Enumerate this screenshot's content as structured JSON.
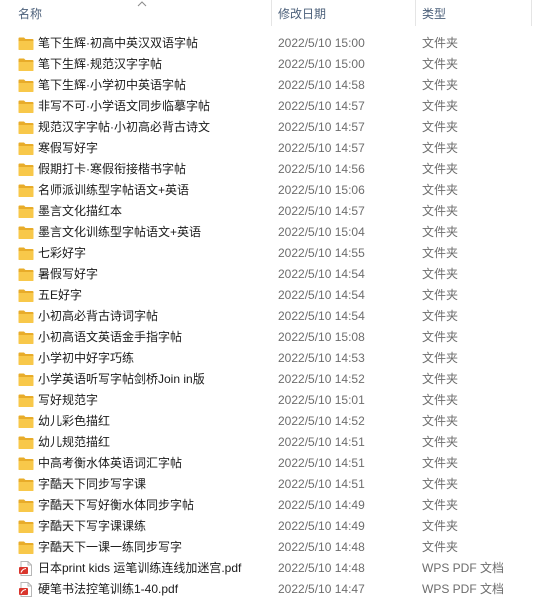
{
  "header": {
    "name_label": "名称",
    "date_label": "修改日期",
    "type_label": "类型"
  },
  "icons": {
    "folder": "folder-icon",
    "pdf": "pdf-icon"
  },
  "colors": {
    "folder": "#f8c84a",
    "pdf_accent": "#d9352c"
  },
  "files": [
    {
      "name": "笔下生辉·初高中英汉双语字帖",
      "date": "2022/5/10 15:00",
      "type": "文件夹",
      "kind": "folder"
    },
    {
      "name": "笔下生辉·规范汉字字帖",
      "date": "2022/5/10 15:00",
      "type": "文件夹",
      "kind": "folder"
    },
    {
      "name": "笔下生辉·小学初中英语字帖",
      "date": "2022/5/10 14:58",
      "type": "文件夹",
      "kind": "folder"
    },
    {
      "name": "非写不可·小学语文同步临摹字帖",
      "date": "2022/5/10 14:57",
      "type": "文件夹",
      "kind": "folder"
    },
    {
      "name": "规范汉字字帖·小初高必背古诗文",
      "date": "2022/5/10 14:57",
      "type": "文件夹",
      "kind": "folder"
    },
    {
      "name": "寒假写好字",
      "date": "2022/5/10 14:57",
      "type": "文件夹",
      "kind": "folder"
    },
    {
      "name": "假期打卡·寒假衔接楷书字帖",
      "date": "2022/5/10 14:56",
      "type": "文件夹",
      "kind": "folder"
    },
    {
      "name": "名师派训练型字帖语文+英语",
      "date": "2022/5/10 15:06",
      "type": "文件夹",
      "kind": "folder"
    },
    {
      "name": "墨言文化描红本",
      "date": "2022/5/10 14:57",
      "type": "文件夹",
      "kind": "folder"
    },
    {
      "name": "墨言文化训练型字帖语文+英语",
      "date": "2022/5/10 15:04",
      "type": "文件夹",
      "kind": "folder"
    },
    {
      "name": "七彩好字",
      "date": "2022/5/10 14:55",
      "type": "文件夹",
      "kind": "folder"
    },
    {
      "name": "暑假写好字",
      "date": "2022/5/10 14:54",
      "type": "文件夹",
      "kind": "folder"
    },
    {
      "name": "五E好字",
      "date": "2022/5/10 14:54",
      "type": "文件夹",
      "kind": "folder"
    },
    {
      "name": "小初高必背古诗词字帖",
      "date": "2022/5/10 14:54",
      "type": "文件夹",
      "kind": "folder"
    },
    {
      "name": "小初高语文英语金手指字帖",
      "date": "2022/5/10 15:08",
      "type": "文件夹",
      "kind": "folder"
    },
    {
      "name": "小学初中好字巧练",
      "date": "2022/5/10 14:53",
      "type": "文件夹",
      "kind": "folder"
    },
    {
      "name": "小学英语听写字帖剑桥Join in版",
      "date": "2022/5/10 14:52",
      "type": "文件夹",
      "kind": "folder"
    },
    {
      "name": "写好规范字",
      "date": "2022/5/10 15:01",
      "type": "文件夹",
      "kind": "folder"
    },
    {
      "name": "幼儿彩色描红",
      "date": "2022/5/10 14:52",
      "type": "文件夹",
      "kind": "folder"
    },
    {
      "name": "幼儿规范描红",
      "date": "2022/5/10 14:51",
      "type": "文件夹",
      "kind": "folder"
    },
    {
      "name": "中高考衡水体英语词汇字帖",
      "date": "2022/5/10 14:51",
      "type": "文件夹",
      "kind": "folder"
    },
    {
      "name": "字酷天下同步写字课",
      "date": "2022/5/10 14:51",
      "type": "文件夹",
      "kind": "folder"
    },
    {
      "name": "字酷天下写好衡水体同步字帖",
      "date": "2022/5/10 14:49",
      "type": "文件夹",
      "kind": "folder"
    },
    {
      "name": "字酷天下写字课课练",
      "date": "2022/5/10 14:49",
      "type": "文件夹",
      "kind": "folder"
    },
    {
      "name": "字酷天下一课一练同步写字",
      "date": "2022/5/10 14:48",
      "type": "文件夹",
      "kind": "folder"
    },
    {
      "name": "日本print kids 运笔训练连线加迷宫.pdf",
      "date": "2022/5/10 14:48",
      "type": "WPS PDF 文档",
      "kind": "pdf"
    },
    {
      "name": "硬笔书法控笔训练1-40.pdf",
      "date": "2022/5/10 14:47",
      "type": "WPS PDF 文档",
      "kind": "pdf"
    }
  ]
}
